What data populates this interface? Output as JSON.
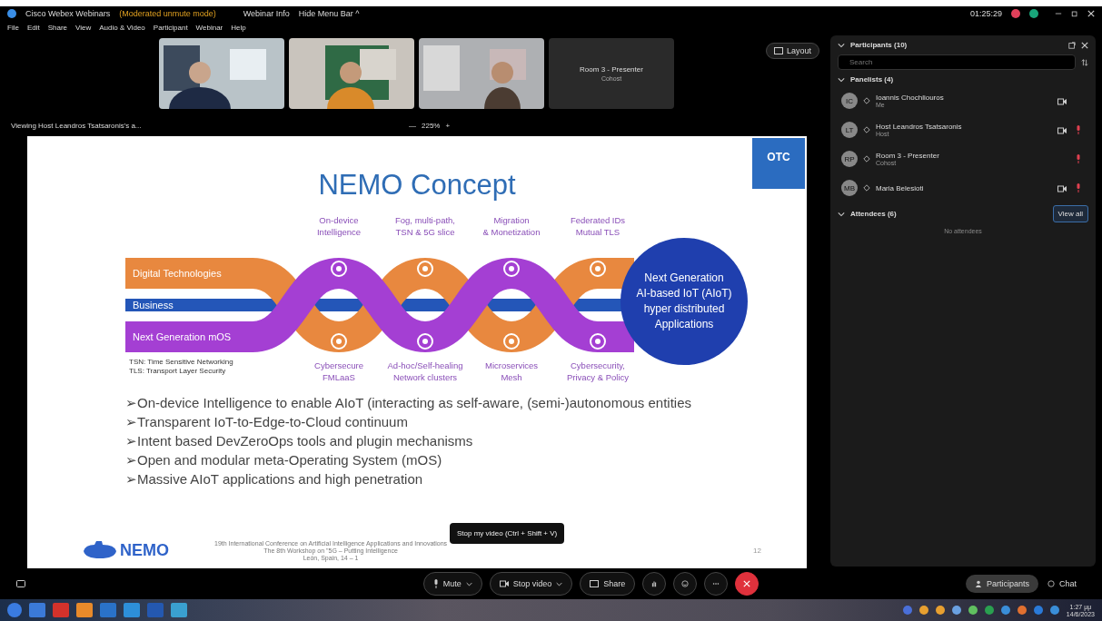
{
  "window": {
    "title": "Cisco Webex Webinars",
    "mode": "(Moderated unmute mode)",
    "info": "Webinar Info",
    "hide_menu": "Hide Menu Bar ^",
    "clock": "01:25:29"
  },
  "menu": [
    "File",
    "Edit",
    "Share",
    "View",
    "Audio & Video",
    "Participant",
    "Webinar",
    "Help"
  ],
  "videos": [
    {
      "kind": "picture"
    },
    {
      "kind": "picture"
    },
    {
      "kind": "picture"
    },
    {
      "kind": "tile",
      "name": "Room 3 - Presenter",
      "subtitle": "Cohost"
    }
  ],
  "layout_button": "Layout",
  "viewing": {
    "label": "Viewing Host Leandros Tsatsaronis's a...",
    "zoom": "225%",
    "minus": "—",
    "plus": "+"
  },
  "slide": {
    "title": "NEMO Concept",
    "badge": "OTC",
    "bands": [
      "Digital Technologies",
      "Business",
      "Next Generation mOS"
    ],
    "top_labels": [
      [
        "On-device",
        "Intelligence"
      ],
      [
        "Fog, multi-path,",
        "TSN & 5G slice"
      ],
      [
        "Migration",
        "& Monetization"
      ],
      [
        "Federated IDs",
        "Mutual TLS"
      ]
    ],
    "bottom_labels": [
      [
        "Cybersecure",
        "FMLaaS"
      ],
      [
        "Ad-hoc/Self-healing",
        "Network clusters"
      ],
      [
        "Microservices",
        "Mesh"
      ],
      [
        "Cybersecurity,",
        "Privacy & Policy"
      ]
    ],
    "footnotes": [
      "TSN: Time Sensitive Networking",
      "TLS: Transport Layer Security"
    ],
    "circle": [
      "Next Generation",
      "AI-based IoT (AIoT)",
      "hyper distributed",
      "Applications"
    ],
    "bullets": [
      "➢On-device Intelligence to enable AIoT (interacting as self-aware, (semi-)autonomous entities",
      "➢Transparent IoT-to-Edge-to-Cloud continuum",
      "➢Intent based DevZeroOps tools and plugin mechanisms",
      "➢Open and modular meta-Operating System (mOS)",
      "➢Massive AIoT applications and high penetration"
    ],
    "logo": "NEMO",
    "footer": [
      "19th International Conference on Artificial Intelligence Applications and Innovations",
      "The 8th Workshop on \"5G – Putting Intelligence",
      "León, Spain, 14 – 1"
    ],
    "page": "12"
  },
  "tooltip": "Stop my video (Ctrl + Shift + V)",
  "participants": {
    "title": "Participants (10)",
    "search_placeholder": "Search",
    "panelists_header": "Panelists (4)",
    "panelists": [
      {
        "initials": "IC",
        "name": "Ioannis Chochliouros",
        "role": "Me",
        "video": true,
        "muted": false
      },
      {
        "initials": "LT",
        "name": "Host Leandros Tsatsaronis",
        "role": "Host",
        "video": true,
        "muted": true
      },
      {
        "initials": "RP",
        "name": "Room 3 - Presenter",
        "role": "Cohost",
        "video": false,
        "muted": true
      },
      {
        "initials": "MB",
        "name": "Maria Belesioti",
        "video": true,
        "muted": true
      }
    ],
    "attendees_header": "Attendees (6)",
    "view_all": "View all",
    "empty": "No attendees"
  },
  "controls": [
    {
      "kind": "mute",
      "label": "Mute"
    },
    {
      "kind": "video",
      "label": "Stop video"
    },
    {
      "kind": "share",
      "label": "Share"
    }
  ],
  "side_tabs": [
    {
      "label": "Participants",
      "selected": true
    },
    {
      "label": "Chat",
      "selected": false
    }
  ],
  "taskbar": {
    "time": "1:27 μμ",
    "date": "14/6/2023"
  }
}
